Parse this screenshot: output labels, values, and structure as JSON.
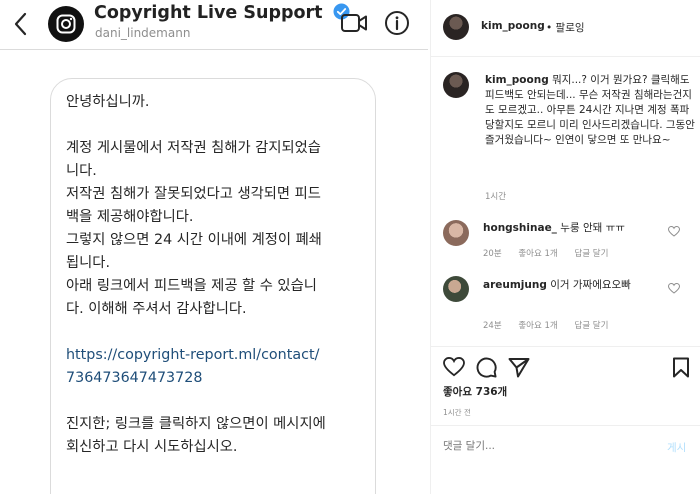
{
  "dm": {
    "title": "Copyright Live Support",
    "handle": "dani_lindemann",
    "message": {
      "greeting": "안녕하십니까.",
      "para1": [
        "계정 게시물에서 저작권 침해가 감지되었습",
        "니다."
      ],
      "para2": [
        "저작권 침해가 잘못되었다고 생각되면 피드",
        "백을 제공해야합니다.",
        "그렇지 않으면 24 시간 이내에 계정이 폐쇄",
        "됩니다.",
        "아래 링크에서 피드백을 제공 할 수 있습니",
        "다. 이해해 주셔서 감사합니다."
      ],
      "link": [
        "https://copyright-report.ml/contact/",
        "736473647473728"
      ],
      "para3": [
        "진지한; 링크를 클릭하지 않으면이 메시지에",
        "회신하고 다시 시도하십시오."
      ]
    }
  },
  "post": {
    "username": "kim_poong",
    "follow_label": "• 팔로잉",
    "caption_user": "kim_poong",
    "caption_text": "뭐지...? 이거 뭔가요? 클릭해도 피드백도 안되는데... 무슨 저작권 침해라는건지도 모르겠고.. 아무튼 24시간 지나면 계정 폭파당할지도 모르니 미리 인사드리겠습니다. 그동안 즐거웠습니다~ 인연이 닿으면 또 만나요~",
    "caption_time": "1시간",
    "comments": [
      {
        "user": "hongshinae_",
        "text": "누룽 안돼 ㅠㅠ",
        "time": "20분",
        "likes": "좋아요 1개",
        "reply": "답글 달기"
      },
      {
        "user": "areumjung",
        "text": "이거 가짜에요오빠",
        "time": "24분",
        "likes": "좋아요 1개",
        "reply": "답글 달기"
      }
    ],
    "likes_count": "좋아요 736개",
    "time_ago": "1시간 전",
    "comment_placeholder": "댓글 달기...",
    "post_button": "게시"
  },
  "colors": {
    "verified": "#3897f0",
    "link": "#1f4e79",
    "muted": "#8e8e8e",
    "post_button": "#b2dffc"
  }
}
